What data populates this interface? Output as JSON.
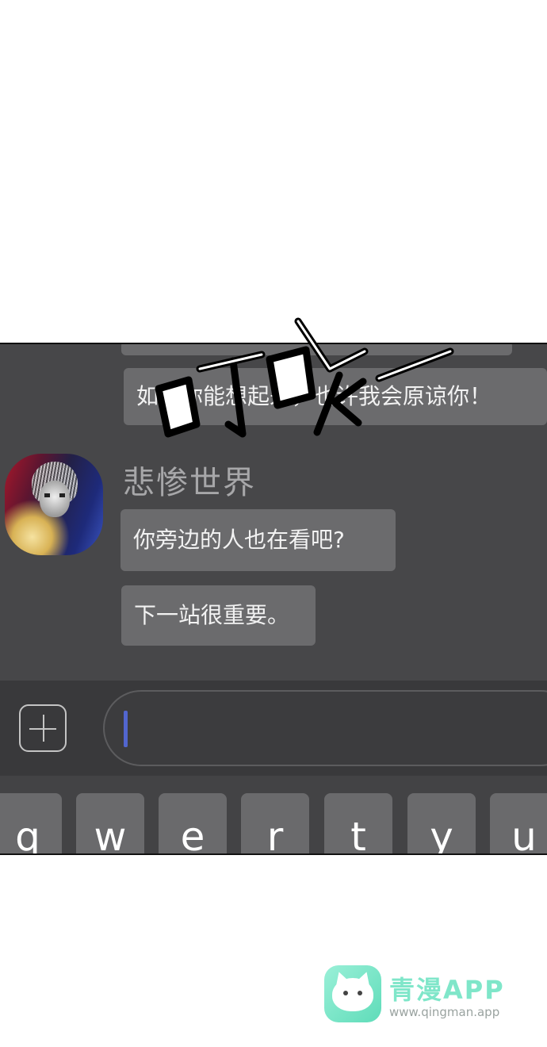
{
  "chat": {
    "partial_bubble_text": "",
    "prev_message": "如果你能想起来，也许我会原谅你！",
    "sender_name": "悲惨世界",
    "messages": [
      {
        "text": "你旁边的人也在看吧?"
      },
      {
        "text": "下一站很重要。"
      }
    ]
  },
  "sound_effect": "叮咚——",
  "input_bar": {
    "add_icon": "plus-square-icon",
    "field_value": ""
  },
  "keyboard": {
    "keys": [
      "q",
      "w",
      "e",
      "r",
      "t",
      "y",
      "u"
    ]
  },
  "watermark": {
    "title": "青漫APP",
    "url": "www.qingman.app",
    "icon": "cat-logo-icon"
  },
  "colors": {
    "panel_bg": "#474749",
    "bubble_bg": "#6b6b6d",
    "cursor": "#5266cf",
    "watermark_accent": "#7fe6c9"
  }
}
